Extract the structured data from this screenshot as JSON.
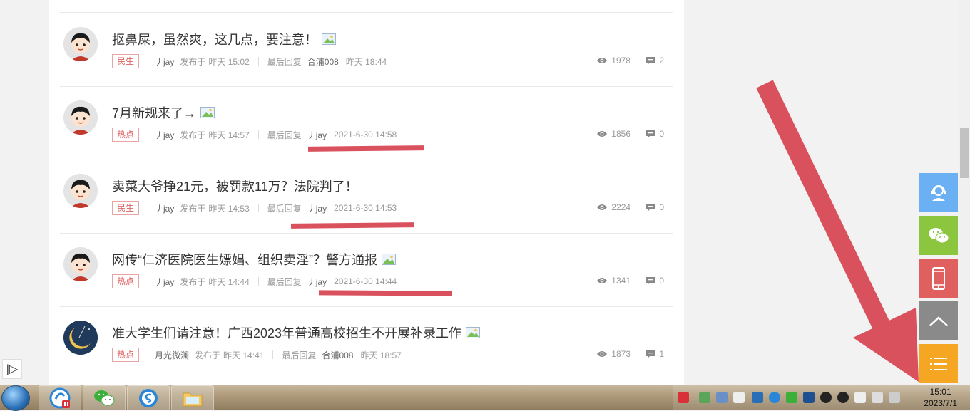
{
  "posts": [
    {
      "title": "抠鼻屎，虽然爽，这几点，要注意！",
      "tag": "民生",
      "author": "丿jay",
      "posted_label": "发布于",
      "posted_time": "昨天 15:02",
      "last_reply_label": "最后回复",
      "last_user": "合浦008",
      "last_time": "昨天 18:44",
      "views": "1978",
      "replies": "2",
      "avatar": "boy"
    },
    {
      "title": "7月新规来了→",
      "tag": "热点",
      "author": "丿jay",
      "posted_label": "发布于",
      "posted_time": "昨天 14:57",
      "last_reply_label": "最后回复",
      "last_user": "丿jay",
      "last_time": "2021-6-30 14:58",
      "views": "1856",
      "replies": "0",
      "avatar": "boy"
    },
    {
      "title": "卖菜大爷挣21元，被罚款11万？法院判了！",
      "tag": "民生",
      "author": "丿jay",
      "posted_label": "发布于",
      "posted_time": "昨天 14:53",
      "last_reply_label": "最后回复",
      "last_user": "丿jay",
      "last_time": "2021-6-30 14:53",
      "views": "2224",
      "replies": "0",
      "avatar": "boy"
    },
    {
      "title": "网传“仁济医院医生嫖娼、组织卖淫”？警方通报",
      "tag": "热点",
      "author": "丿jay",
      "posted_label": "发布于",
      "posted_time": "昨天 14:44",
      "last_reply_label": "最后回复",
      "last_user": "丿jay",
      "last_time": "2021-6-30 14:44",
      "views": "1341",
      "replies": "0",
      "avatar": "boy"
    },
    {
      "title": "准大学生们请注意！广西2023年普通高校招生不开展补录工作",
      "tag": "热点",
      "author": "月光微澜",
      "posted_label": "发布于",
      "posted_time": "昨天 14:41",
      "last_reply_label": "最后回复",
      "last_user": "合浦008",
      "last_time": "昨天 18:57",
      "views": "1873",
      "replies": "1",
      "avatar": "moon"
    }
  ],
  "side_buttons": [
    {
      "icon": "customer-service-icon",
      "color": "#6ab0f3"
    },
    {
      "icon": "wechat-icon",
      "color": "#8cc63f"
    },
    {
      "icon": "mobile-phone-icon",
      "color": "#e06060"
    },
    {
      "icon": "back-to-top-icon",
      "color": "#8a8a8a"
    },
    {
      "icon": "menu-list-icon",
      "color": "#f5a623"
    }
  ],
  "clock": {
    "time": "15:01",
    "date": "2023/7/1"
  },
  "annotation_color": "#d9515c"
}
